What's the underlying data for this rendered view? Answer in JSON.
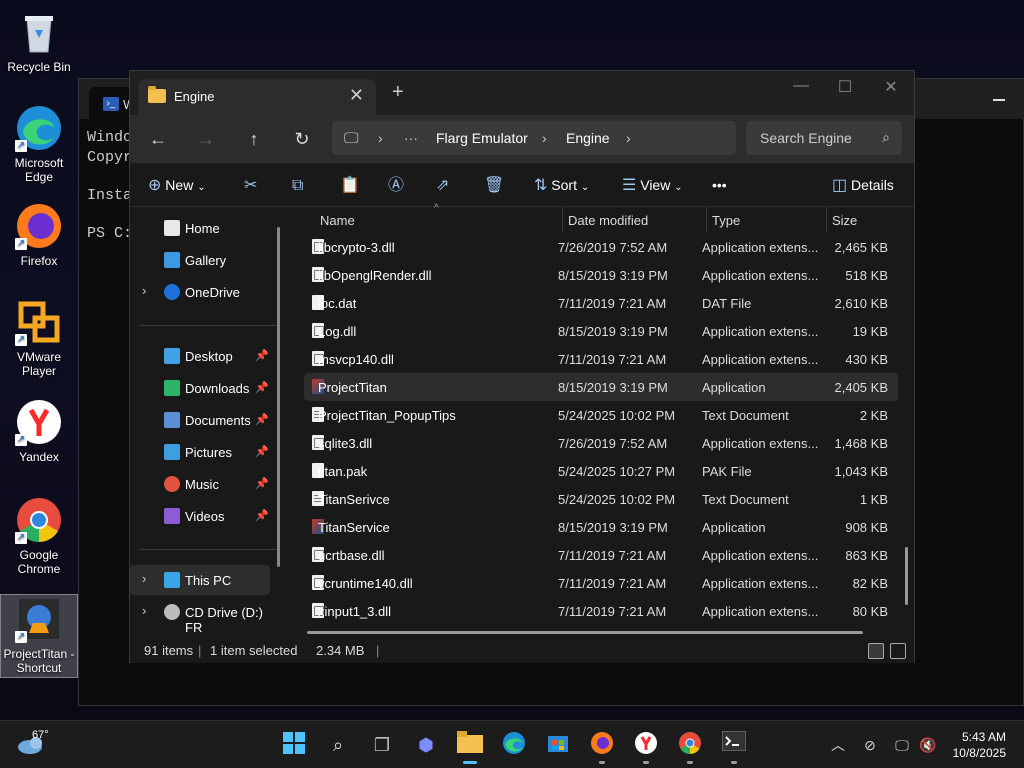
{
  "desktop": {
    "icons": [
      {
        "label": "Recycle Bin",
        "icon": "recycle-bin-icon"
      },
      {
        "label": "Microsoft Edge",
        "icon": "edge-icon"
      },
      {
        "label": "Firefox",
        "icon": "firefox-icon"
      },
      {
        "label": "VMware Player",
        "icon": "vmware-icon"
      },
      {
        "label": "Yandex",
        "icon": "yandex-icon"
      },
      {
        "label": "Google Chrome",
        "icon": "chrome-icon"
      },
      {
        "label": "ProjectTitan - Shortcut",
        "icon": "project-titan-icon"
      }
    ]
  },
  "terminal": {
    "tab_title": "W",
    "lines": [
      "Windo",
      "Copyr",
      "Insta",
      "PS C:"
    ]
  },
  "explorer": {
    "tab_title": "Engine",
    "new_tab": "+",
    "address": {
      "segments": [
        "Flarg Emulator",
        "Engine"
      ],
      "ellipsis": "···"
    },
    "search_placeholder": "Search Engine",
    "toolbar": {
      "new_label": "New",
      "sort_label": "Sort",
      "view_label": "View",
      "details_label": "Details",
      "more": "•••"
    },
    "nav": {
      "home": "Home",
      "gallery": "Gallery",
      "onedrive": "OneDrive",
      "desktop": "Desktop",
      "downloads": "Downloads",
      "documents": "Documents",
      "pictures": "Pictures",
      "music": "Music",
      "videos": "Videos",
      "thispc": "This PC",
      "cddrive": "CD Drive (D:) FR"
    },
    "columns": {
      "name": "Name",
      "date": "Date modified",
      "type": "Type",
      "size": "Size"
    },
    "files": [
      {
        "name": "libcrypto-3.dll",
        "date": "7/26/2019 7:52 AM",
        "type": "Application extens...",
        "size": "2,465 KB",
        "kind": "dll"
      },
      {
        "name": "libOpenglRender.dll",
        "date": "8/15/2019 3:19 PM",
        "type": "Application extens...",
        "size": "518 KB",
        "kind": "dll"
      },
      {
        "name": "loc.dat",
        "date": "7/11/2019 7:21 AM",
        "type": "DAT File",
        "size": "2,610 KB",
        "kind": "file"
      },
      {
        "name": "Log.dll",
        "date": "8/15/2019 3:19 PM",
        "type": "Application extens...",
        "size": "19 KB",
        "kind": "dll"
      },
      {
        "name": "msvcp140.dll",
        "date": "7/11/2019 7:21 AM",
        "type": "Application extens...",
        "size": "430 KB",
        "kind": "dll"
      },
      {
        "name": "ProjectTitan",
        "date": "8/15/2019 3:19 PM",
        "type": "Application",
        "size": "2,405 KB",
        "kind": "app"
      },
      {
        "name": "ProjectTitan_PopupTips",
        "date": "5/24/2025 10:02 PM",
        "type": "Text Document",
        "size": "2 KB",
        "kind": "txt"
      },
      {
        "name": "sqlite3.dll",
        "date": "7/26/2019 7:52 AM",
        "type": "Application extens...",
        "size": "1,468 KB",
        "kind": "dll"
      },
      {
        "name": "titan.pak",
        "date": "5/24/2025 10:27 PM",
        "type": "PAK File",
        "size": "1,043 KB",
        "kind": "file"
      },
      {
        "name": "TitanSerivce",
        "date": "5/24/2025 10:02 PM",
        "type": "Text Document",
        "size": "1 KB",
        "kind": "txt"
      },
      {
        "name": "TitanService",
        "date": "8/15/2019 3:19 PM",
        "type": "Application",
        "size": "908 KB",
        "kind": "app"
      },
      {
        "name": "ucrtbase.dll",
        "date": "7/11/2019 7:21 AM",
        "type": "Application extens...",
        "size": "863 KB",
        "kind": "dll"
      },
      {
        "name": "vcruntime140.dll",
        "date": "7/11/2019 7:21 AM",
        "type": "Application extens...",
        "size": "82 KB",
        "kind": "dll"
      },
      {
        "name": "xinput1_3.dll",
        "date": "7/11/2019 7:21 AM",
        "type": "Application extens...",
        "size": "80 KB",
        "kind": "dll"
      }
    ],
    "selected_index": 5,
    "status": {
      "items": "91 items",
      "selected": "1 item selected",
      "size": "2.34 MB"
    }
  },
  "taskbar": {
    "weather_temp": "67°",
    "time": "5:43 AM",
    "date": "10/8/2025",
    "apps": [
      "start-icon",
      "search-icon",
      "task-view-icon",
      "copilot-icon",
      "file-explorer-icon",
      "edge-icon",
      "store-icon",
      "firefox-icon",
      "yandex-icon",
      "chrome-icon",
      "terminal-icon"
    ]
  },
  "colors": {
    "accent": "#4cc2ff",
    "folder": "#f2c14e",
    "window_bg": "#191919"
  }
}
